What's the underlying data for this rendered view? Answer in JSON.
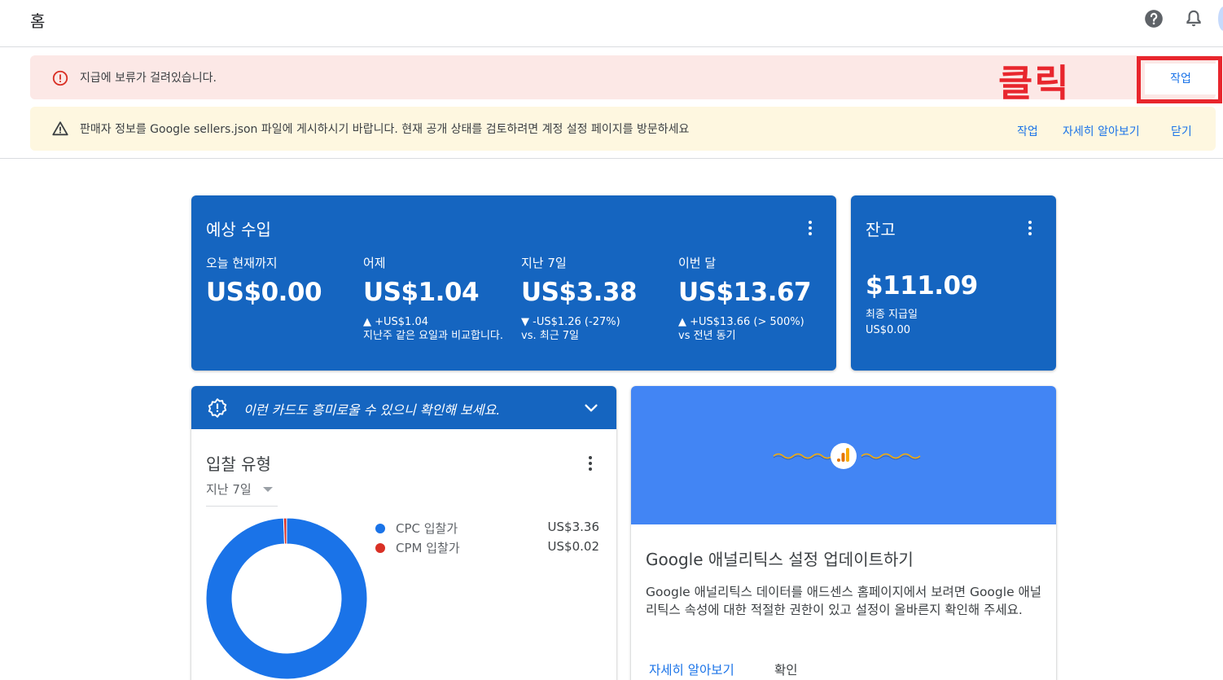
{
  "header": {
    "title": "홈",
    "help_icon": "help-circle-icon",
    "bell_icon": "notification-bell-icon"
  },
  "alerts": {
    "error": {
      "icon": "error-circle-icon",
      "text": "지급에 보류가 걸려있습니다.",
      "action": "작업"
    },
    "warning": {
      "icon": "warning-triangle-icon",
      "text": "판매자 정보를 Google sellers.json 파일에 게시하시기 바랍니다. 현재 공개 상태를 검토하려면 계정 설정 페이지를 방문하세요",
      "action": "작업",
      "learn_more": "자세히 알아보기",
      "dismiss": "닫기"
    }
  },
  "annotation": {
    "text": "클릭",
    "color": "#e8262d"
  },
  "earnings": {
    "title": "예상 수입",
    "stats": [
      {
        "label": "오늘 현재까지",
        "value": "US$0.00",
        "change": "",
        "compare": ""
      },
      {
        "label": "어제",
        "value": "US$1.04",
        "change": "▲ +US$1.04",
        "compare": "지난주 같은 요일과 비교합니다."
      },
      {
        "label": "지난 7일",
        "value": "US$3.38",
        "change": "▼ -US$1.26 (-27%)",
        "compare": "vs. 최근 7일"
      },
      {
        "label": "이번 달",
        "value": "US$13.67",
        "change": "▲ +US$13.66 (> 500%)",
        "compare": "vs 전년 동기"
      }
    ]
  },
  "balance": {
    "title": "잔고",
    "value": "$111.09",
    "last_payment_label": "최종 지급일",
    "last_payment_value": "US$0.00"
  },
  "suggestion": {
    "icon": "badge-alert-icon",
    "text": "이런 카드도 흥미로울 수 있으니 확인해 보세요.",
    "chevron": "chevron-down-icon"
  },
  "bid_types": {
    "title": "입찰 유형",
    "range": "지난 7일",
    "items": [
      {
        "name": "CPC 입찰가",
        "value": "US$3.36",
        "color": "#1a73e8"
      },
      {
        "name": "CPM 입찰가",
        "value": "US$0.02",
        "color": "#d93025"
      }
    ]
  },
  "chart_data": {
    "type": "pie",
    "categories": [
      "CPC 입찰가",
      "CPM 입찰가"
    ],
    "values": [
      3.36,
      0.02
    ],
    "colors": [
      "#1a73e8",
      "#d93025"
    ],
    "donut": true
  },
  "analytics": {
    "hero_icon": "analytics-logo-icon",
    "title": "Google 애널리틱스 설정 업데이트하기",
    "description": "Google 애널리틱스 데이터를 애드센스 홈페이지에서 보려면 Google 애널리틱스 속성에 대한 적절한 권한이 있고 설정이 올바른지 확인해 주세요.",
    "learn_more": "자세히 알아보기",
    "confirm": "확인"
  },
  "colors": {
    "primary_blue": "#1565c0",
    "hero_blue": "#4285f4",
    "link_blue": "#1a73e8",
    "error_bg": "#fce8e6",
    "warning_bg": "#fef7e0"
  }
}
